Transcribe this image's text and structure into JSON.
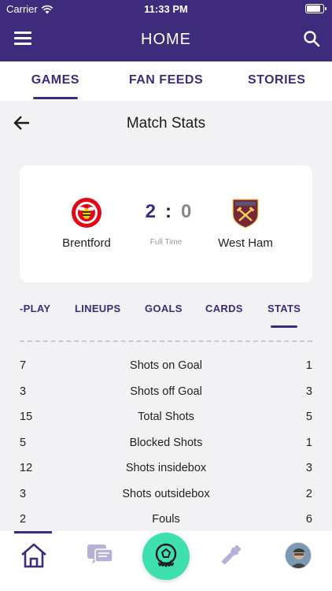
{
  "status_bar": {
    "carrier": "Carrier",
    "time": "11:33 PM"
  },
  "app_bar": {
    "title": "HOME"
  },
  "tabs": [
    {
      "label": "GAMES",
      "active": true
    },
    {
      "label": "FAN FEEDS",
      "active": false
    },
    {
      "label": "STORIES",
      "active": false
    }
  ],
  "subhead": {
    "title": "Match Stats"
  },
  "match": {
    "home_team": "Brentford",
    "away_team": "West Ham",
    "home_score": "2",
    "separator": ":",
    "away_score": "0",
    "status": "Full Time"
  },
  "sub_tabs": [
    {
      "label": "-PLAY",
      "active": false
    },
    {
      "label": "LINEUPS",
      "active": false
    },
    {
      "label": "GOALS",
      "active": false
    },
    {
      "label": "CARDS",
      "active": false
    },
    {
      "label": "STATS",
      "active": true
    }
  ],
  "stats": [
    {
      "home": "7",
      "label": "Shots on Goal",
      "away": "1"
    },
    {
      "home": "3",
      "label": "Shots off Goal",
      "away": "3"
    },
    {
      "home": "15",
      "label": "Total Shots",
      "away": "5"
    },
    {
      "home": "5",
      "label": "Blocked Shots",
      "away": "1"
    },
    {
      "home": "12",
      "label": "Shots insidebox",
      "away": "3"
    },
    {
      "home": "3",
      "label": "Shots outsidebox",
      "away": "2"
    },
    {
      "home": "2",
      "label": "Fouls",
      "away": "6"
    }
  ],
  "bottom_nav": [
    {
      "icon": "home-icon",
      "active": true
    },
    {
      "icon": "chat-icon",
      "active": false
    },
    {
      "icon": "ball-icon",
      "active": false
    },
    {
      "icon": "flashlight-icon",
      "active": false
    },
    {
      "icon": "avatar",
      "active": false
    }
  ],
  "colors": {
    "primary": "#3f2b7c",
    "accent": "#3fe0b0",
    "background": "#f2f2f4"
  }
}
